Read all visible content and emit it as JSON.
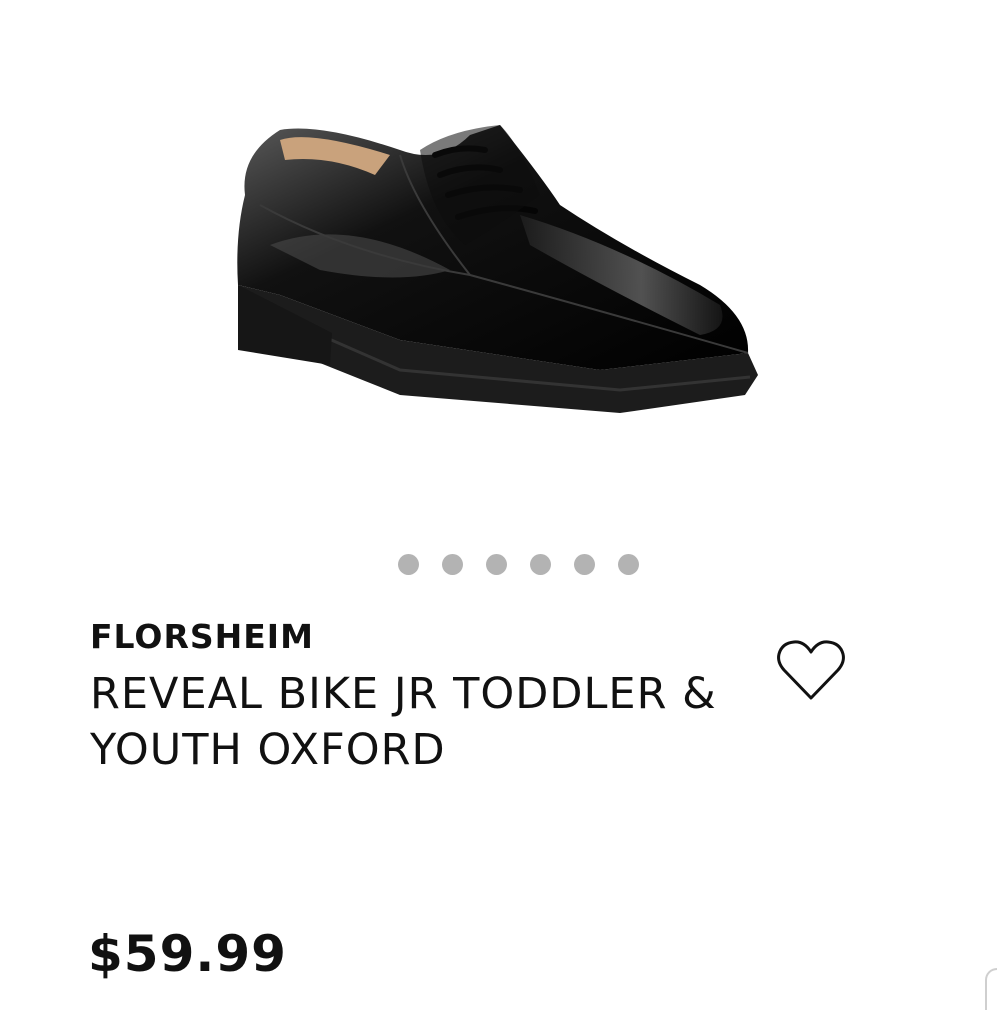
{
  "product": {
    "brand": "FLORSHEIM",
    "title": "REVEAL BIKE JR TODDLER & YOUTH OXFORD",
    "price": "$59.99"
  },
  "carousel": {
    "dot_count": 6,
    "dot_color": "#b3b3b3"
  },
  "icons": {
    "wishlist": "heart-outline-icon"
  },
  "colors": {
    "text": "#111111",
    "background": "#ffffff",
    "shoe": "#0a0a0a"
  }
}
